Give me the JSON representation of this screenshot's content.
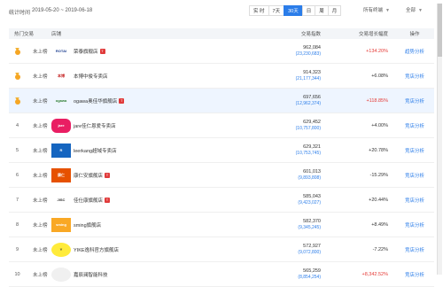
{
  "header": {
    "stat_label": "统计时间",
    "stat_range": "2019-05-20 ~ 2019-06-18",
    "ranges": [
      "实 时",
      "7天",
      "30天",
      "日",
      "周",
      "月"
    ],
    "active_range": 2,
    "terminal_dropdown": "所有终端",
    "all_dropdown": "全部"
  },
  "columns": {
    "rank": "热门交易",
    "shop": "店铺",
    "index": "交易指数",
    "growth": "交易增长幅度",
    "op": "操作"
  },
  "rows": [
    {
      "rank": "",
      "medal": true,
      "status": "未上榜",
      "logo": "ROTAI",
      "shop": "荣泰旗舰店",
      "tm": true,
      "index": "962,084",
      "sub": "(23,230,683)",
      "growth": "+134.20%",
      "growth_type": "pos",
      "op": "趋势分析",
      "highlight": false
    },
    {
      "rank": "",
      "medal": true,
      "status": "未上榜",
      "logo": "本博",
      "shop": "本博中俊专卖店",
      "tm": false,
      "index": "914,323",
      "sub": "(21,177,344)",
      "growth": "+6.08%",
      "growth_type": "neg",
      "op": "竞店分析",
      "highlight": false
    },
    {
      "rank": "",
      "medal": true,
      "status": "未上榜",
      "logo": "ogawa",
      "shop": "ogawa奥佳华旗舰店",
      "tm": true,
      "index": "697,656",
      "sub": "(12,962,374)",
      "growth": "+118.85%",
      "growth_type": "pos",
      "op": "竞店分析",
      "highlight": true
    },
    {
      "rank": "4",
      "medal": false,
      "status": "未上榜",
      "logo": "jare",
      "shop": "jare佳仁恩爱专卖店",
      "tm": false,
      "index": "629,452",
      "sub": "(10,757,800)",
      "growth": "+4.00%",
      "growth_type": "neg",
      "op": "竞店分析",
      "highlight": false
    },
    {
      "rank": "5",
      "medal": false,
      "status": "未上榜",
      "logo": "R",
      "shop": "leerkang超域专卖店",
      "tm": false,
      "index": "629,321",
      "sub": "(10,753,745)",
      "growth": "+20.78%",
      "growth_type": "neg",
      "op": "竞店分析",
      "highlight": false
    },
    {
      "rank": "6",
      "medal": false,
      "status": "未上榜",
      "logo": "康仁",
      "shop": "康仁安旗舰店",
      "tm": true,
      "index": "601,013",
      "sub": "(9,893,808)",
      "growth": "-15.29%",
      "growth_type": "neg",
      "op": "竞店分析",
      "highlight": false
    },
    {
      "rank": "7",
      "medal": false,
      "status": "未上榜",
      "logo": "JISC",
      "shop": "佳仕康旗舰店",
      "tm": true,
      "index": "585,043",
      "sub": "(9,423,027)",
      "growth": "+20.44%",
      "growth_type": "neg",
      "op": "竞店分析",
      "highlight": false
    },
    {
      "rank": "8",
      "medal": false,
      "status": "未上榜",
      "logo": "sming",
      "shop": "sming旗舰店",
      "tm": false,
      "index": "582,370",
      "sub": "(9,345,245)",
      "growth": "+8.49%",
      "growth_type": "neg",
      "op": "竞店分析",
      "highlight": false
    },
    {
      "rank": "9",
      "medal": false,
      "status": "未上榜",
      "logo": "Y",
      "shop": "YIKE逸科官方旗舰店",
      "tm": false,
      "index": "572,927",
      "sub": "(9,072,800)",
      "growth": "-7.22%",
      "growth_type": "neg",
      "op": "竞店分析",
      "highlight": false
    },
    {
      "rank": "10",
      "medal": false,
      "status": "未上榜",
      "logo": "",
      "shop": "嘉辰澜智能科技",
      "tm": false,
      "index": "565,259",
      "sub": "(8,854,254)",
      "growth": "+8,342.52%",
      "growth_type": "pos",
      "op": "竞店分析",
      "highlight": false
    }
  ],
  "colors": {
    "accent": "#2b7de9",
    "positive": "#e53935",
    "tmall": "#e03a3a",
    "medal": "#f6a623"
  }
}
